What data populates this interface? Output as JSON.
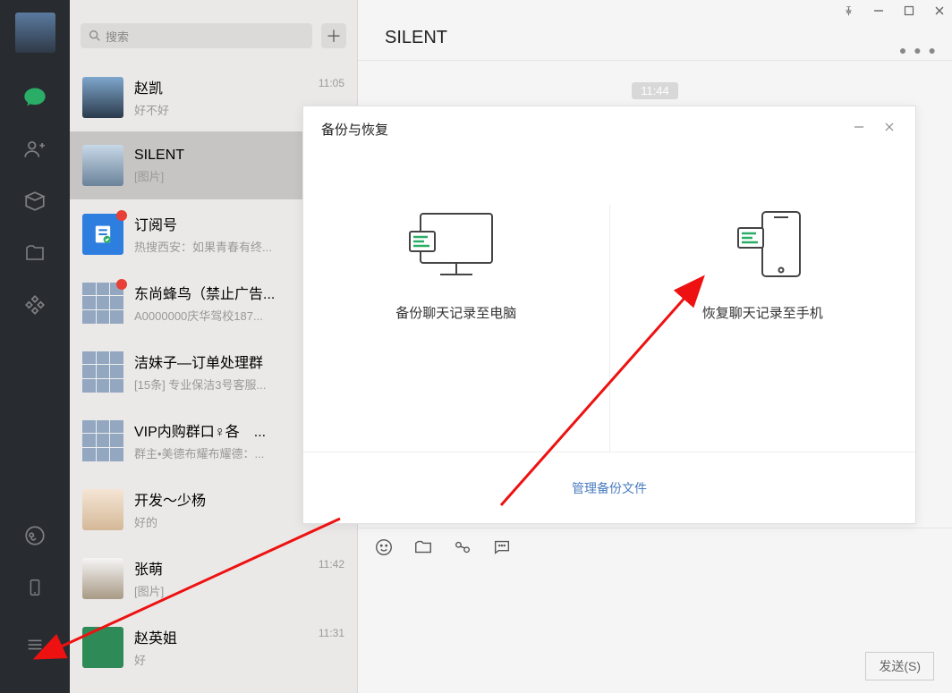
{
  "search": {
    "placeholder": "搜索"
  },
  "header": {
    "title": "SILENT"
  },
  "time_pill": "11:44",
  "send_label": "发送(S)",
  "dialog": {
    "title": "备份与恢复",
    "backup_label": "备份聊天记录至电脑",
    "restore_label": "恢复聊天记录至手机",
    "manage_link": "管理备份文件"
  },
  "chats": [
    {
      "name": "赵凯",
      "preview": "好不好",
      "time": "11:05",
      "avatarClass": "sky"
    },
    {
      "name": "SILENT",
      "preview": "[图片]",
      "time": "",
      "avatarClass": "silent",
      "active": true
    },
    {
      "name": "订阅号",
      "preview": "热搜西安：如果青春有终...",
      "time": "",
      "avatarClass": "sub",
      "badge": true
    },
    {
      "name": "东尚蜂鸟（禁止广告...",
      "preview": "A0000000庆华驾校187...",
      "time": "",
      "avatarClass": "grid",
      "badge": true
    },
    {
      "name": "洁妹子—订单处理群",
      "preview": "[15条] 专业保洁3号客服...",
      "time": "",
      "avatarClass": "grid"
    },
    {
      "name": "VIP内购群口♀各　...",
      "preview": "群主•美德布耀布耀德：...",
      "time": "",
      "avatarClass": "grid"
    },
    {
      "name": "开发～少杨",
      "preview": "好的",
      "time": "",
      "avatarClass": "child"
    },
    {
      "name": "张萌",
      "preview": "[图片]",
      "time": "11:42",
      "avatarClass": "anime"
    },
    {
      "name": "赵英姐",
      "preview": "好",
      "time": "11:31",
      "avatarClass": "green"
    }
  ]
}
